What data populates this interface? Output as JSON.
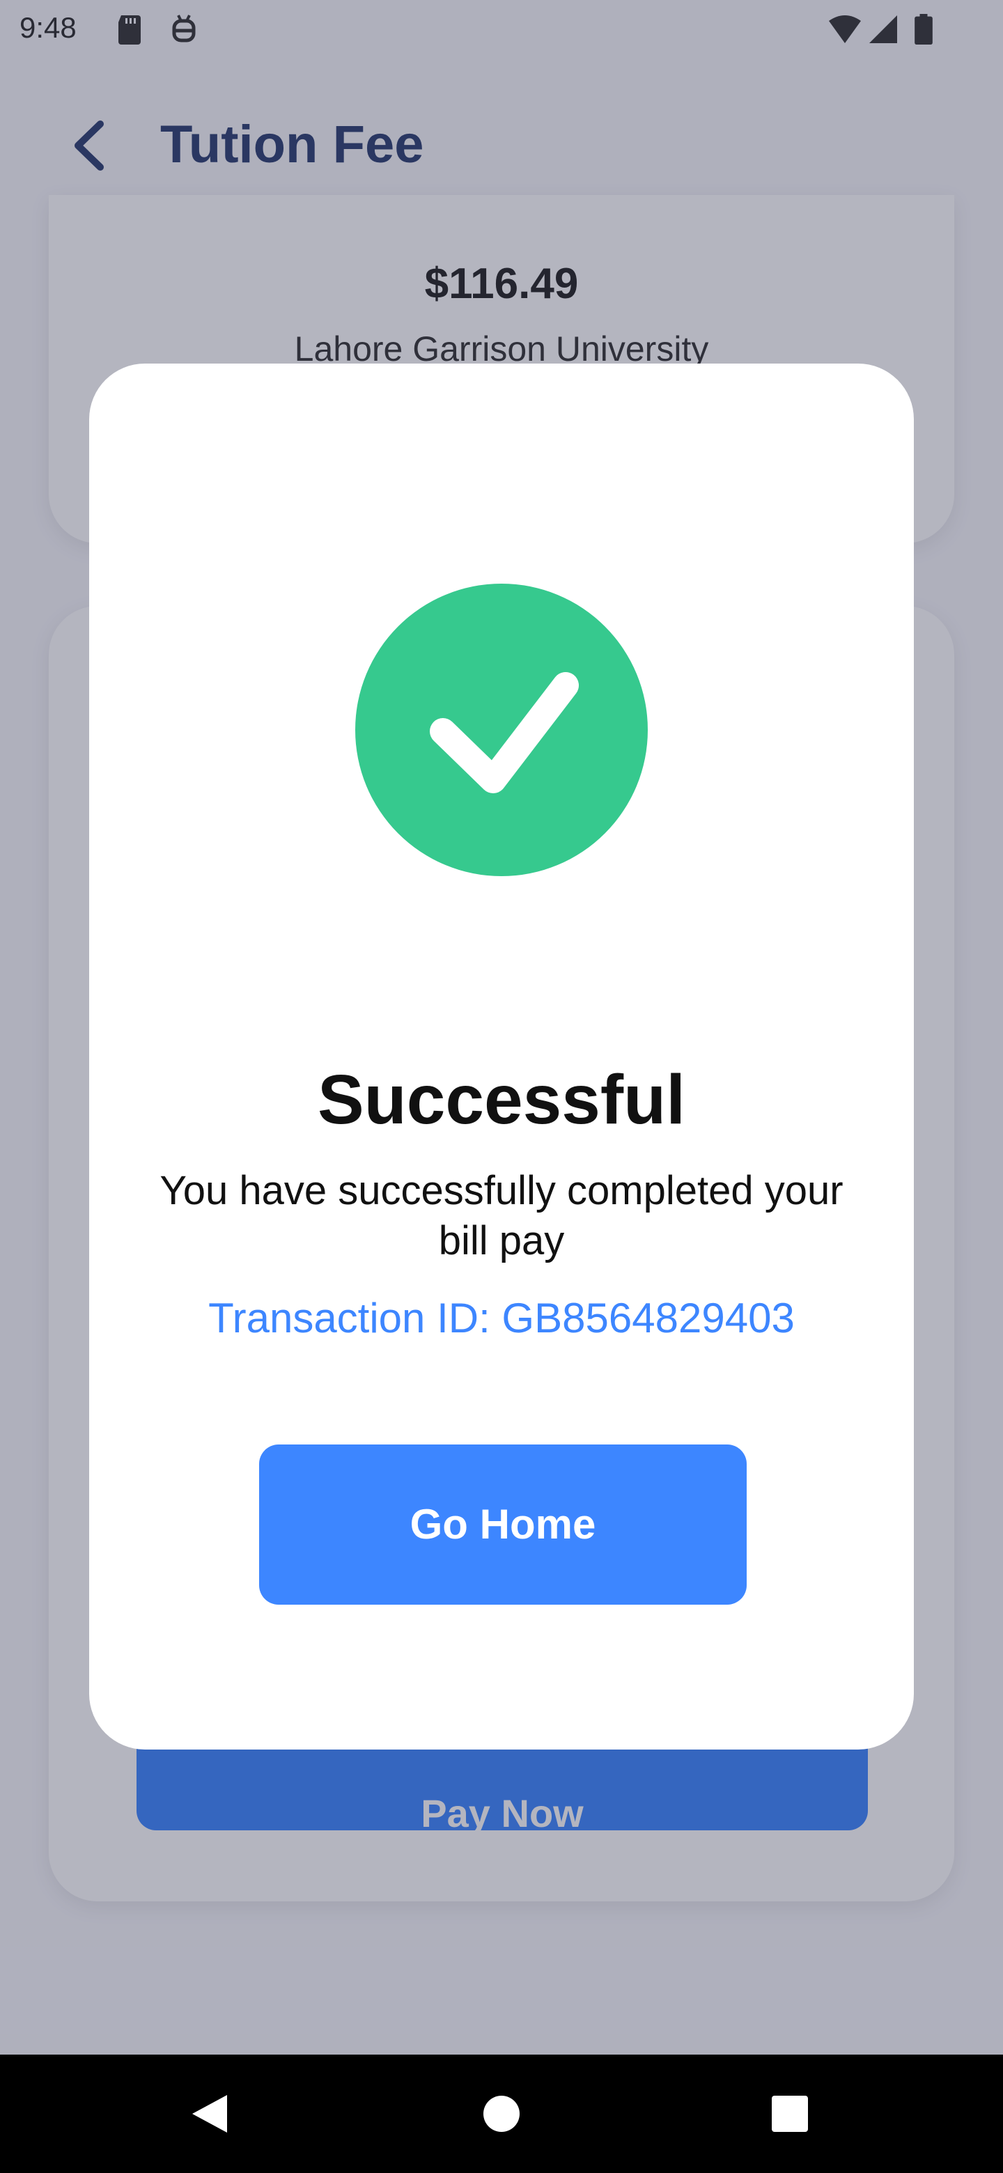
{
  "status_bar": {
    "time": "9:48",
    "icons": [
      "sd-card-icon",
      "debug-icon",
      "wifi-icon",
      "signal-icon",
      "battery-icon"
    ]
  },
  "header": {
    "title": "Tution Fee",
    "back_icon": "back-arrow-icon"
  },
  "bill_card": {
    "amount": "$116.49",
    "institution": "Lahore Garrison University"
  },
  "payment_card": {
    "pay_button_label": "Pay Now"
  },
  "dialog": {
    "icon": "check-circle-icon",
    "title": "Successful",
    "message": "You have successfully completed your bill pay",
    "transaction_id": "Transaction ID: GB8564829403",
    "button_label": "Go Home"
  },
  "nav_bar": {
    "buttons": [
      "back-triangle-icon",
      "home-circle-icon",
      "recents-square-icon"
    ]
  },
  "colors": {
    "accent": "#3d86ff",
    "success": "#36c98e",
    "title_text": "#2c3e70"
  }
}
